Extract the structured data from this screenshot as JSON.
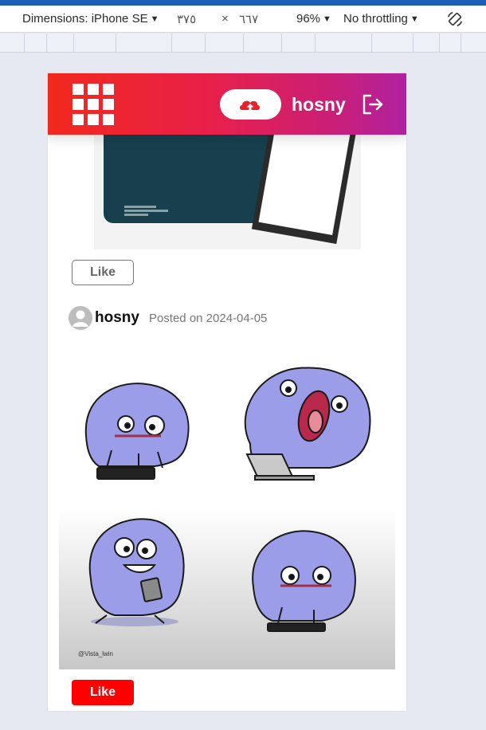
{
  "devtools": {
    "dimensions_label": "Dimensions: iPhone SE",
    "width_value": "٣٧٥",
    "times": "×",
    "height_value": "٦٦٧",
    "zoom": "96%",
    "throttling": "No throttling"
  },
  "header": {
    "username": "hosny"
  },
  "posts": [
    {
      "like_label": "Like"
    },
    {
      "author": "hosny",
      "posted": "Posted on 2024-04-05",
      "like_label": "Like"
    }
  ],
  "colors": {
    "header_gradient_start": "#f2291c",
    "header_gradient_end": "#b021a0",
    "like_active": "#ff0000"
  }
}
